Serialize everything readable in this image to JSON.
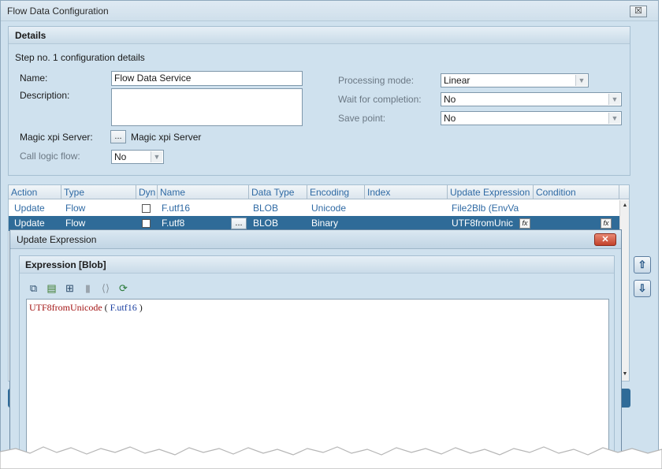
{
  "window": {
    "title": "Flow Data Configuration",
    "close_label": "☒"
  },
  "details": {
    "title": "Details",
    "step_caption": "Step no. 1 configuration details",
    "name_label": "Name:",
    "name_value": "Flow Data Service",
    "description_label": "Description:",
    "description_value": "",
    "server_label": "Magic xpi Server:",
    "server_button": "...",
    "server_value": "Magic xpi Server",
    "call_logic_label": "Call logic flow:",
    "call_logic_value": "No",
    "processing_mode_label": "Processing mode:",
    "processing_mode_value": "Linear",
    "wait_label": "Wait for completion:",
    "wait_value": "No",
    "save_point_label": "Save point:",
    "save_point_value": "No"
  },
  "grid": {
    "columns": [
      "Action",
      "Type",
      "Dyn",
      "Name",
      "Data Type",
      "Encoding",
      "Index",
      "Update Expression",
      "Condition"
    ],
    "rows": [
      {
        "action": "Update",
        "type": "Flow",
        "dyn": false,
        "name": "F.utf16",
        "data_type": "BLOB",
        "encoding": "Unicode",
        "index": "",
        "update_expression": "File2Blb (EnvVa",
        "condition": "",
        "selected": false
      },
      {
        "action": "Update",
        "type": "Flow",
        "dyn": false,
        "name": "F.utf8",
        "data_type": "BLOB",
        "encoding": "Binary",
        "index": "",
        "update_expression": "UTF8fromUnic",
        "condition": "",
        "selected": true,
        "name_button": "..."
      }
    ],
    "fx_label": "fx"
  },
  "side_buttons": {
    "move_up": "⇧",
    "move_down": "⇩"
  },
  "dialog": {
    "title": "Update Expression",
    "close_label": "✕",
    "panel_title": "Expression [Blob]",
    "toolbar_icons": [
      "expression-editor-icon",
      "functions-icon",
      "variables-icon",
      "delete-icon",
      "brackets-icon",
      "verify-icon"
    ],
    "toolbar_glyphs": [
      "⧉",
      "▤",
      "⊞",
      "▮",
      "⟨⟩",
      "⟳"
    ],
    "expression": {
      "function": "UTF8fromUnicode",
      "open": " ( ",
      "argument": "F.utf16",
      "close": " )"
    }
  }
}
